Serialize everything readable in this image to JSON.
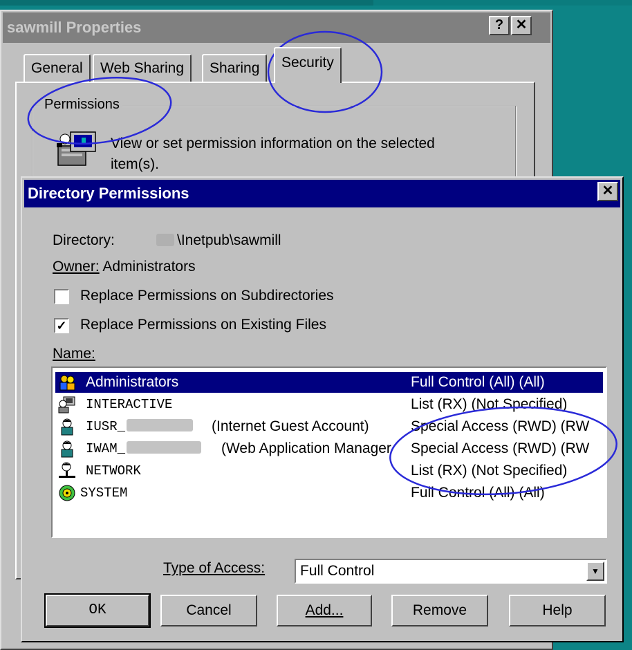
{
  "back_window": {
    "title": "sawmill Properties",
    "help_btn": "?",
    "close_btn": "✕",
    "tabs": [
      "General",
      "Web Sharing",
      "Sharing",
      "Security"
    ],
    "active_tab": "Security",
    "group_label": "Permissions",
    "description": "View or set permission information on the selected item(s)."
  },
  "dialog": {
    "title": "Directory Permissions",
    "close_btn": "✕",
    "directory_label": "Directory:",
    "directory_value": "\\Inetpub\\sawmill",
    "owner_label": "Owner:",
    "owner_value": "Administrators",
    "replace_subdirs": {
      "label": "Replace Permissions on Subdirectories",
      "checked": false
    },
    "replace_files": {
      "label": "Replace Permissions on Existing Files",
      "checked": true,
      "mark": "✓"
    },
    "name_label": "Name:",
    "entries": [
      {
        "name": "Administrators",
        "suffix": "",
        "access": "Full Control (All) (All)",
        "selected": true
      },
      {
        "name": "INTERACTIVE",
        "suffix": "",
        "access": "List (RX) (Not Specified)",
        "selected": false
      },
      {
        "name": "IUSR_",
        "suffix": "(Internet Guest Account)",
        "access": "Special Access (RWD) (RW",
        "selected": false
      },
      {
        "name": "IWAM_",
        "suffix": "(Web Application Manager",
        "access": "Special Access (RWD) (RW",
        "selected": false
      },
      {
        "name": "NETWORK",
        "suffix": "",
        "access": "List (RX) (Not Specified)",
        "selected": false
      },
      {
        "name": "SYSTEM",
        "suffix": "",
        "access": "Full Control (All) (All)",
        "selected": false
      }
    ],
    "type_of_access_label": "Type of Access:",
    "type_of_access_value": "Full Control",
    "buttons": {
      "ok": "OK",
      "cancel": "Cancel",
      "add": "Add...",
      "remove": "Remove",
      "help": "Help"
    }
  },
  "colors": {
    "desktop": "#0d8486",
    "active_title": "#000080",
    "annotation": "#2a2ad8"
  }
}
